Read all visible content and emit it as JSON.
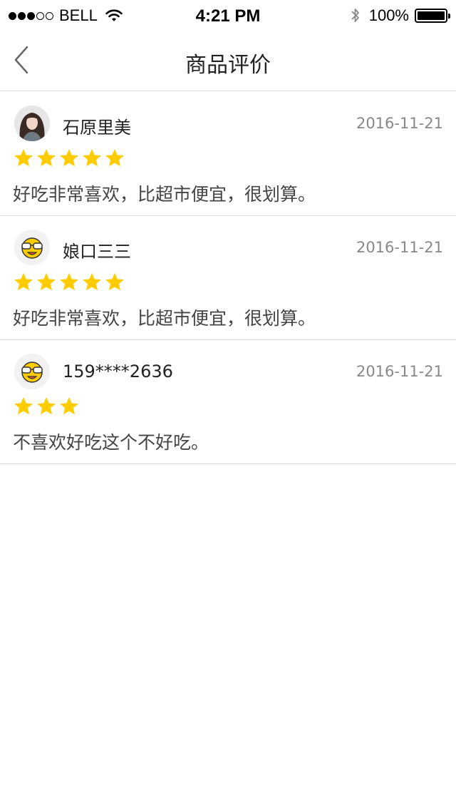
{
  "status_bar": {
    "carrier": "BELL",
    "time": "4:21 PM",
    "battery": "100%",
    "signal_dots": [
      true,
      true,
      true,
      false,
      false
    ]
  },
  "nav": {
    "title": "商品评价",
    "back_icon": "chevron-left-icon"
  },
  "colors": {
    "star": "#FFCC00",
    "divider": "#dcdcdc",
    "date": "#888888"
  },
  "reviews": [
    {
      "avatar": "photo-avatar",
      "name": "石原里美",
      "date": "2016-11-21",
      "rating": 5,
      "comment": "好吃非常喜欢，比超市便宜，很划算。"
    },
    {
      "avatar": "sunglasses-emoji-avatar",
      "name": "娘口三三",
      "date": "2016-11-21",
      "rating": 5,
      "comment": "好吃非常喜欢，比超市便宜，很划算。"
    },
    {
      "avatar": "sunglasses-emoji-avatar",
      "name": "159****2636",
      "date": "2016-11-21",
      "rating": 3,
      "comment": "不喜欢好吃这个不好吃。"
    }
  ]
}
